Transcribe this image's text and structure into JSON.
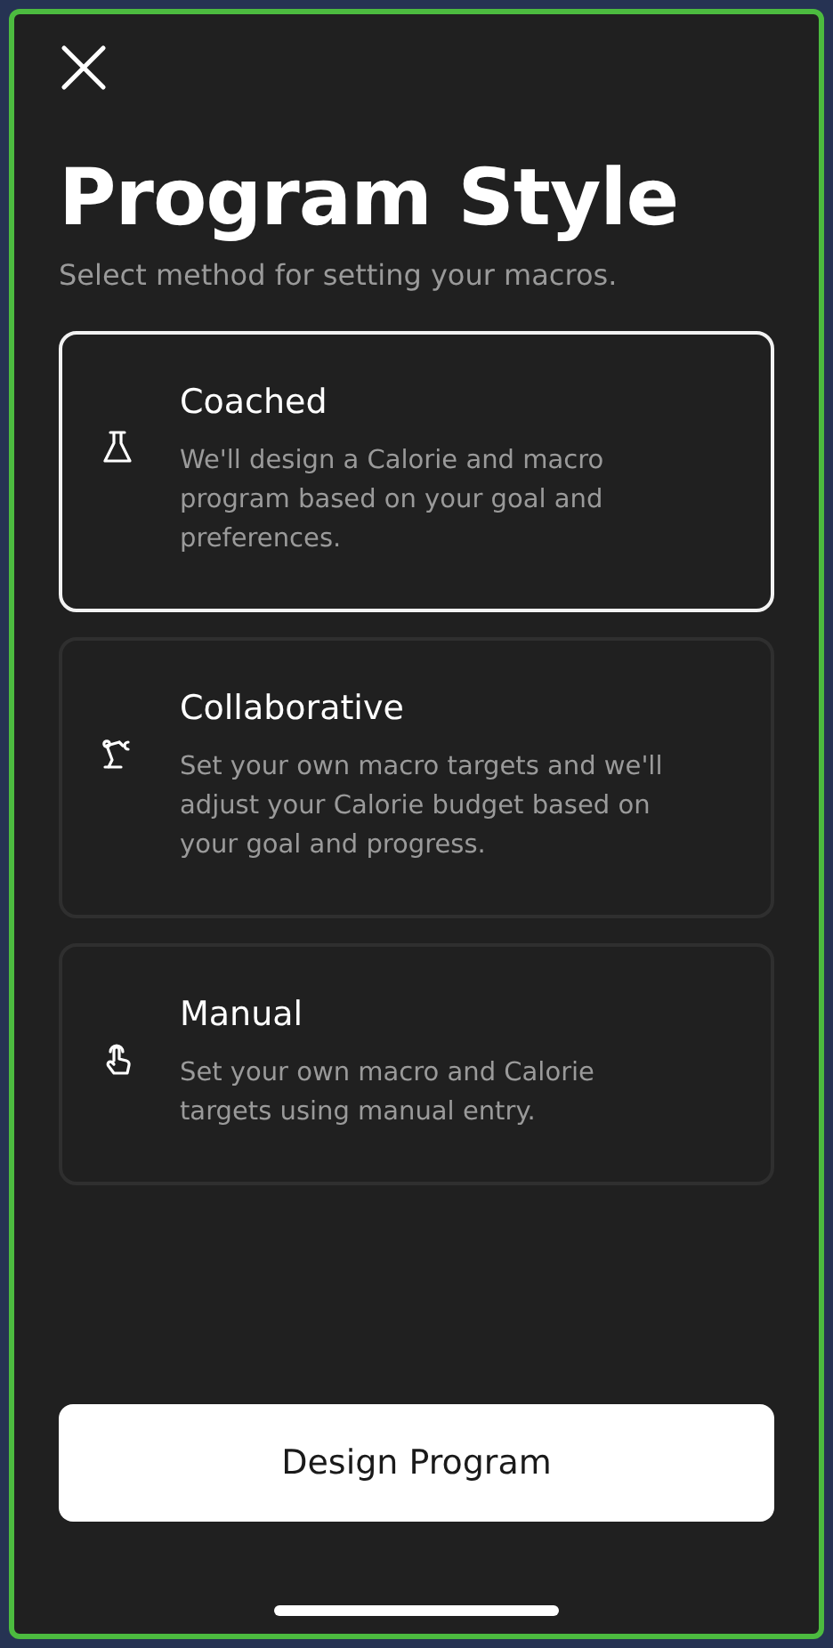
{
  "title": "Program Style",
  "subtitle": "Select method for setting your macros.",
  "options": [
    {
      "kind": "flask",
      "title": "Coached",
      "description": "We'll design a Calorie and macro program based on your goal and preferences.",
      "selected": true
    },
    {
      "kind": "arm",
      "title": "Collaborative",
      "description": "Set your own macro targets and we'll adjust your Calorie budget based on your goal and progress.",
      "selected": false
    },
    {
      "kind": "hand",
      "title": "Manual",
      "description": "Set your own macro and Calorie targets using manual entry.",
      "selected": false
    }
  ],
  "button": "Design Program"
}
